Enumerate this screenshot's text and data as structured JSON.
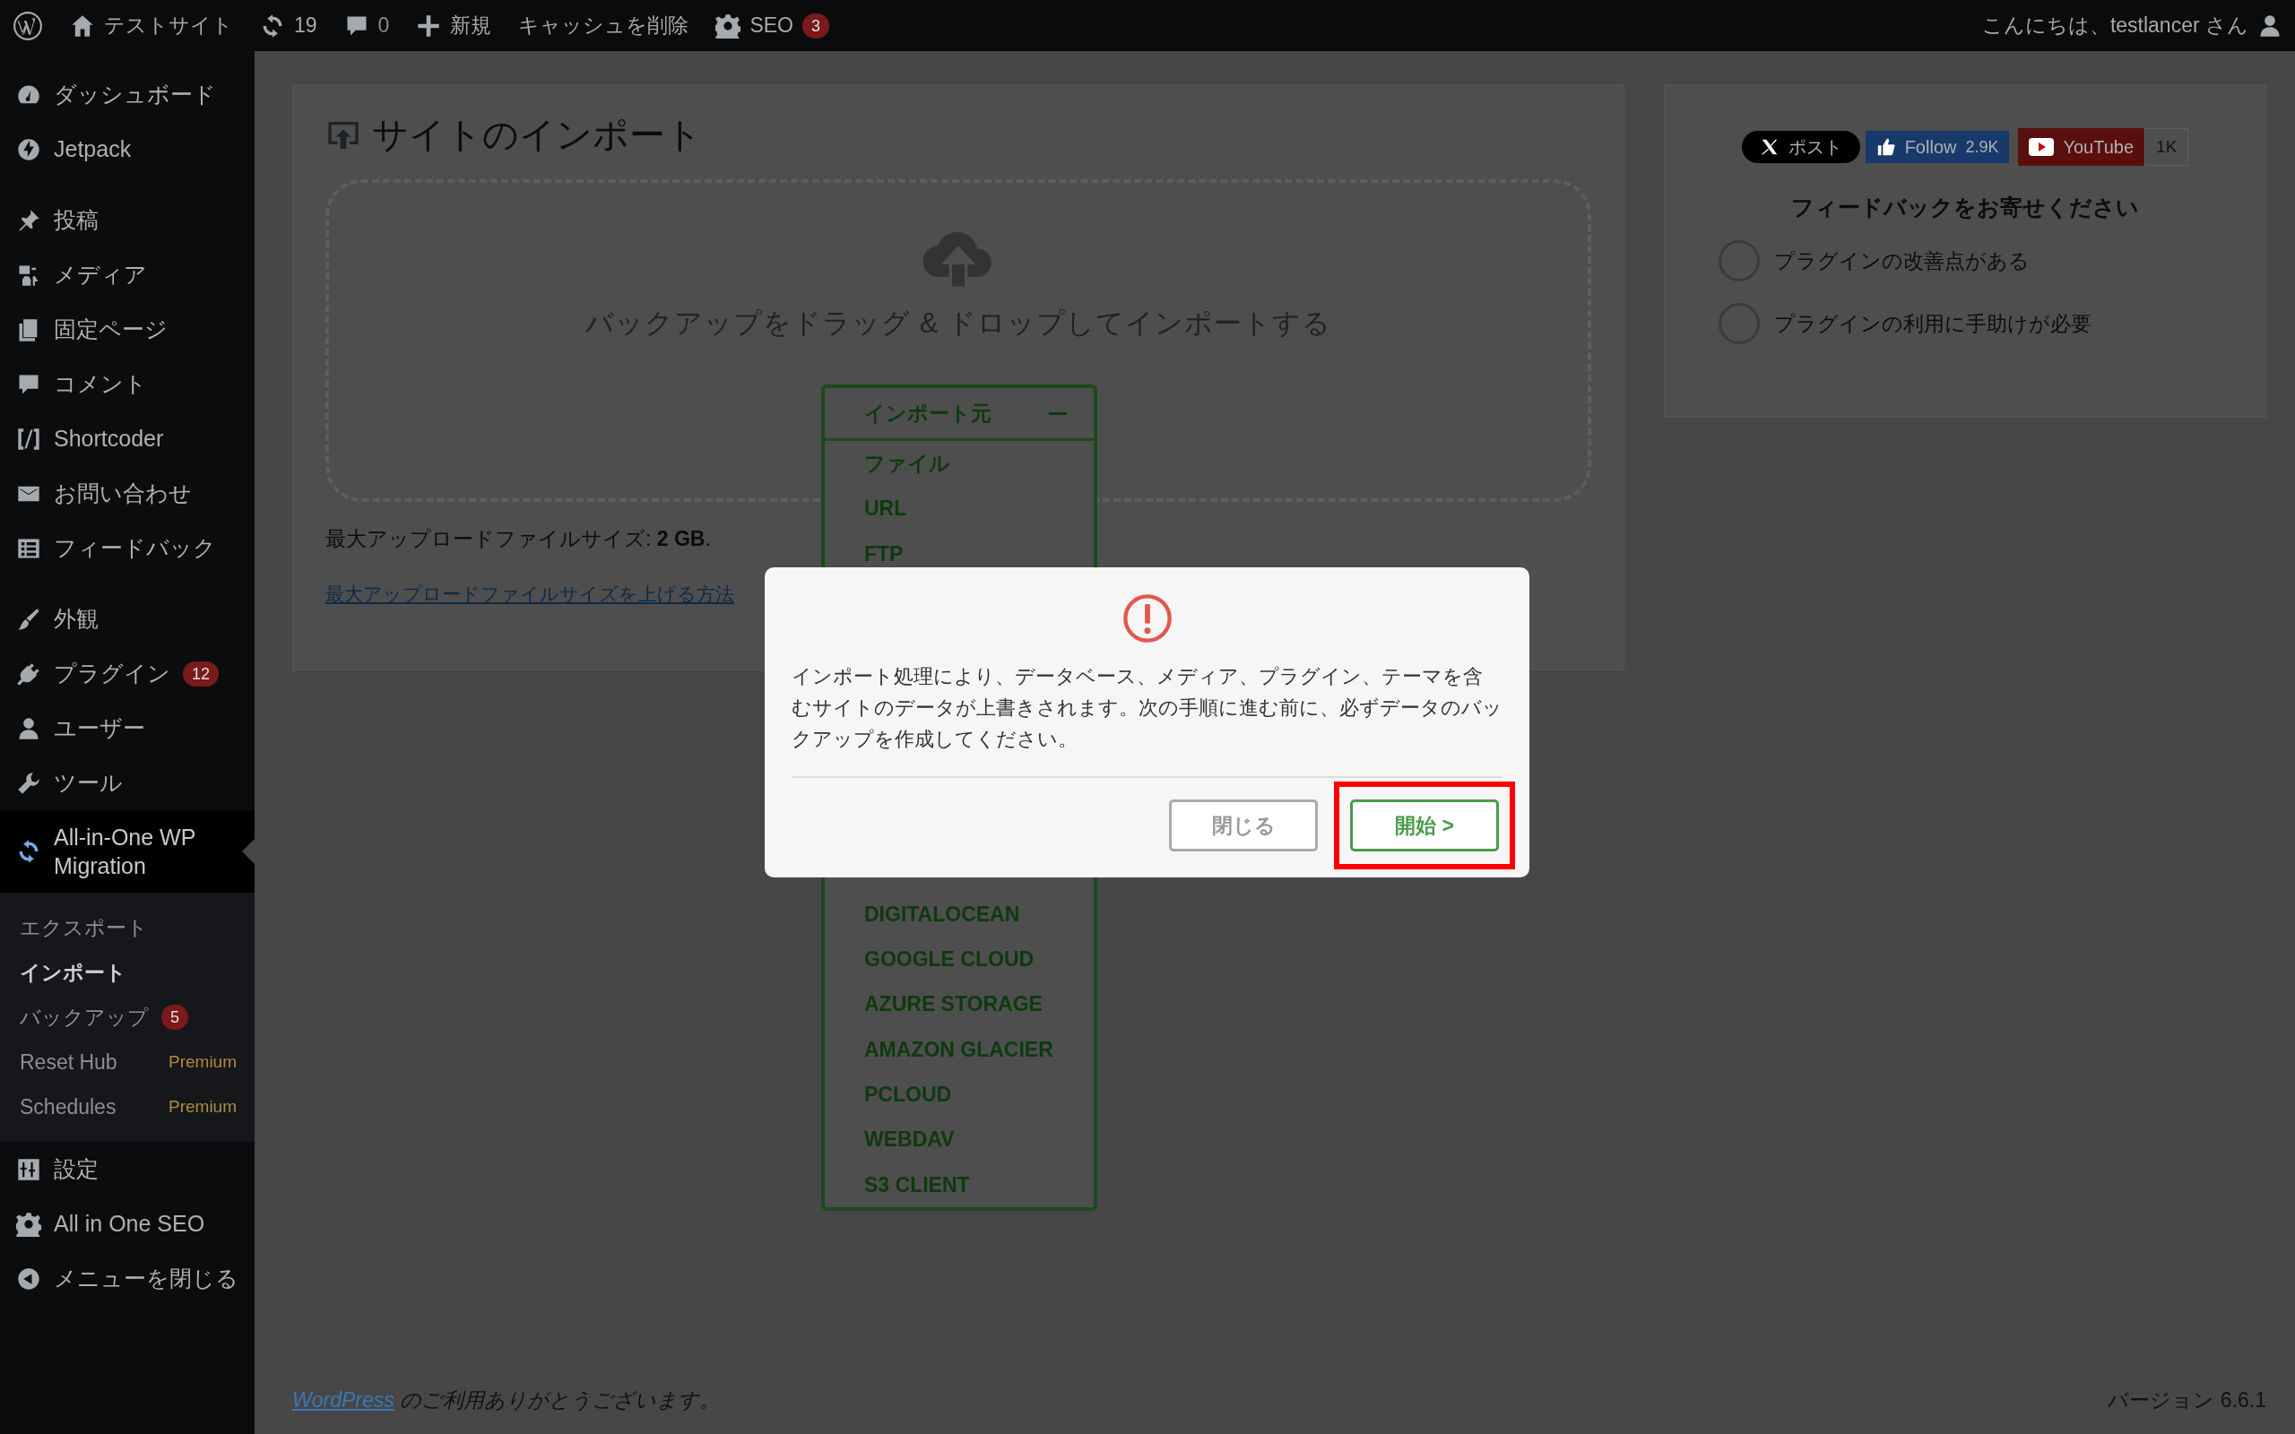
{
  "admin_bar": {
    "items": [
      {
        "kind": "site",
        "label": "テストサイト"
      },
      {
        "kind": "updates",
        "label": "19"
      },
      {
        "kind": "comments",
        "label": "0"
      },
      {
        "kind": "new",
        "label": "新規"
      },
      {
        "kind": "text",
        "label": "キャッシュを削除"
      },
      {
        "kind": "seo",
        "label": "SEO",
        "badge": "3"
      }
    ],
    "greeting": "こんにちは、testlancer さん"
  },
  "sidebar": {
    "groups": [
      [
        {
          "label": "ダッシュボード",
          "selected": false
        },
        {
          "label": "Jetpack",
          "selected": false
        }
      ],
      [
        {
          "label": "投稿",
          "selected": false
        },
        {
          "label": "メディア",
          "selected": false
        },
        {
          "label": "固定ページ",
          "selected": false
        },
        {
          "label": "コメント",
          "selected": false
        },
        {
          "label": "Shortcoder",
          "selected": false
        },
        {
          "label": "お問い合わせ",
          "selected": false
        },
        {
          "label": "フィードバック",
          "selected": false
        }
      ],
      [
        {
          "label": "外観",
          "selected": false
        },
        {
          "label": "プラグイン",
          "selected": false,
          "badge": "12"
        },
        {
          "label": "ユーザー",
          "selected": false
        },
        {
          "label": "ツール",
          "selected": false
        },
        {
          "label": "All-in-One WP Migration",
          "selected": true,
          "children": [
            {
              "label": "エクスポート",
              "selected": false
            },
            {
              "label": "インポート",
              "selected": true
            },
            {
              "label": "バックアップ",
              "selected": false,
              "badge": "5"
            },
            {
              "label": "Reset Hub",
              "selected": false,
              "tag": "Premium"
            },
            {
              "label": "Schedules",
              "selected": false,
              "tag": "Premium"
            }
          ]
        },
        {
          "label": "設定",
          "selected": false
        },
        {
          "label": "All in One SEO",
          "selected": false
        },
        {
          "label": "メニューを閉じる",
          "selected": false
        }
      ]
    ]
  },
  "import_card": {
    "title": "サイトのインポート",
    "drop_text": "バックアップをドラッグ & ドロップしてインポートする",
    "dropdown": {
      "label": "インポート元",
      "expanded": true,
      "items_above": [
        "ファイル",
        "URL",
        "FTP"
      ],
      "items_below": [
        "DIGITALOCEAN",
        "GOOGLE CLOUD",
        "AZURE STORAGE",
        "AMAZON GLACIER",
        "PCLOUD",
        "WEBDAV",
        "S3 CLIENT"
      ]
    },
    "max_size": "最大アップロードファイルサイズ: **2 GB**.",
    "help_link": "最大アップロードファイルサイズを上げる方法"
  },
  "side_card": {
    "social": [
      {
        "kind": "x",
        "label": "ポスト"
      },
      {
        "kind": "facebook",
        "label": "Follow",
        "count": "2.9K"
      },
      {
        "kind": "youtube",
        "label": "YouTube",
        "count": "1K"
      }
    ],
    "feedback_title": "フィードバックをお寄せください",
    "options": [
      {
        "label": "プラグインの改善点がある",
        "selected": false
      },
      {
        "label": "プラグインの利用に手助けが必要",
        "selected": false
      }
    ]
  },
  "dialog": {
    "message": "インポート処理により、データベース、メディア、プラグイン、テーマを含むサイトのデータが上書きされます。次の手順に進む前に、必ずデータのバックアップを作成してください。",
    "buttons": [
      {
        "kind": "secondary",
        "label": "閉じる",
        "highlighted": false
      },
      {
        "kind": "primary",
        "label": "開始 >",
        "highlighted": true
      }
    ]
  },
  "footer": {
    "link": "WordPress",
    "text": "のご利用ありがとうございます。",
    "version": "バージョン 6.6.1"
  }
}
